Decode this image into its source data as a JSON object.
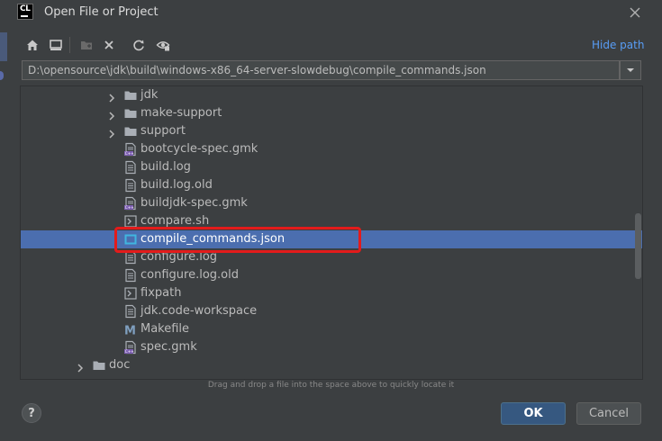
{
  "window": {
    "logo": "CL",
    "title": "Open File or Project",
    "close_icon": "close-icon"
  },
  "toolbar": {
    "home_icon": "home-icon",
    "desktop_icon": "desktop-icon",
    "new_folder_icon": "new-folder-icon",
    "delete_icon": "delete-icon",
    "refresh_icon": "refresh-icon",
    "show_hidden_icon": "show-hidden-icon",
    "hide_path_label": "Hide path"
  },
  "path": {
    "value": "D:\\opensource\\jdk\\build\\windows-x86_64-server-slowdebug\\compile_commands.json"
  },
  "tree": {
    "items": [
      {
        "label": "jdk",
        "type": "folder",
        "expandable": true
      },
      {
        "label": "make-support",
        "type": "folder",
        "expandable": true
      },
      {
        "label": "support",
        "type": "folder",
        "expandable": true
      },
      {
        "label": "bootcycle-spec.gmk",
        "type": "gmk"
      },
      {
        "label": "build.log",
        "type": "text"
      },
      {
        "label": "build.log.old",
        "type": "text"
      },
      {
        "label": "buildjdk-spec.gmk",
        "type": "gmk"
      },
      {
        "label": "compare.sh",
        "type": "shell"
      },
      {
        "label": "compile_commands.json",
        "type": "json",
        "selected": true
      },
      {
        "label": "configure.log",
        "type": "text"
      },
      {
        "label": "configure.log.old",
        "type": "text"
      },
      {
        "label": "fixpath",
        "type": "shell"
      },
      {
        "label": "jdk.code-workspace",
        "type": "text"
      },
      {
        "label": "Makefile",
        "type": "makefile"
      },
      {
        "label": "spec.gmk",
        "type": "gmk"
      },
      {
        "label": "doc",
        "type": "folder",
        "expandable": true
      }
    ]
  },
  "hint": "Drag and drop a file into the space above to quickly locate it",
  "buttons": {
    "help": "?",
    "ok": "OK",
    "cancel": "Cancel"
  },
  "colors": {
    "background": "#3c3f41",
    "selection": "#4b6eaf",
    "link": "#589df6",
    "highlight": "#e31b1b",
    "ok_button": "#365880"
  }
}
